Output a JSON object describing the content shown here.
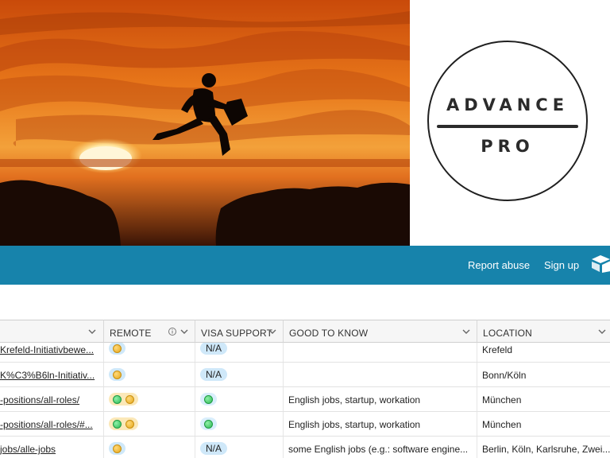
{
  "logo": {
    "top": "ADVANCE",
    "bottom": "PRO"
  },
  "nav": {
    "report_abuse": "Report abuse",
    "sign_up": "Sign up"
  },
  "colors": {
    "nav_bar": "#1783ab",
    "header_bg": "#f6f6f6",
    "pill_blue": "#cfe8f9",
    "dot_yellow": "#f0b429",
    "dot_green": "#2cba55"
  },
  "table": {
    "headers": {
      "remote": "REMOTE",
      "visa_support": "VISA SUPPORT",
      "good_to_know": "GOOD TO KNOW",
      "location": "LOCATION"
    },
    "rows": [
      {
        "link": "Krefeld-Initiativbewe...",
        "remote": [
          "yellow"
        ],
        "visa": "N/A",
        "good": "",
        "location": "Krefeld"
      },
      {
        "link": "K%C3%B6ln-Initiativ...",
        "remote": [
          "yellow"
        ],
        "visa": "N/A",
        "good": "",
        "location": "Bonn/Köln"
      },
      {
        "link": "-positions/all-roles/",
        "remote": [
          "green",
          "yellow"
        ],
        "visa": "green",
        "good": "English jobs, startup, workation",
        "location": "München"
      },
      {
        "link": "-positions/all-roles/#...",
        "remote": [
          "green",
          "yellow"
        ],
        "visa": "green",
        "good": "English jobs, startup, workation",
        "location": "München"
      },
      {
        "link": "jobs/alle-jobs",
        "remote": [
          "yellow"
        ],
        "visa": "N/A",
        "good": "some English jobs (e.g.: software engine...",
        "location": "Berlin, Köln, Karlsruhe, Zwei..."
      }
    ]
  }
}
